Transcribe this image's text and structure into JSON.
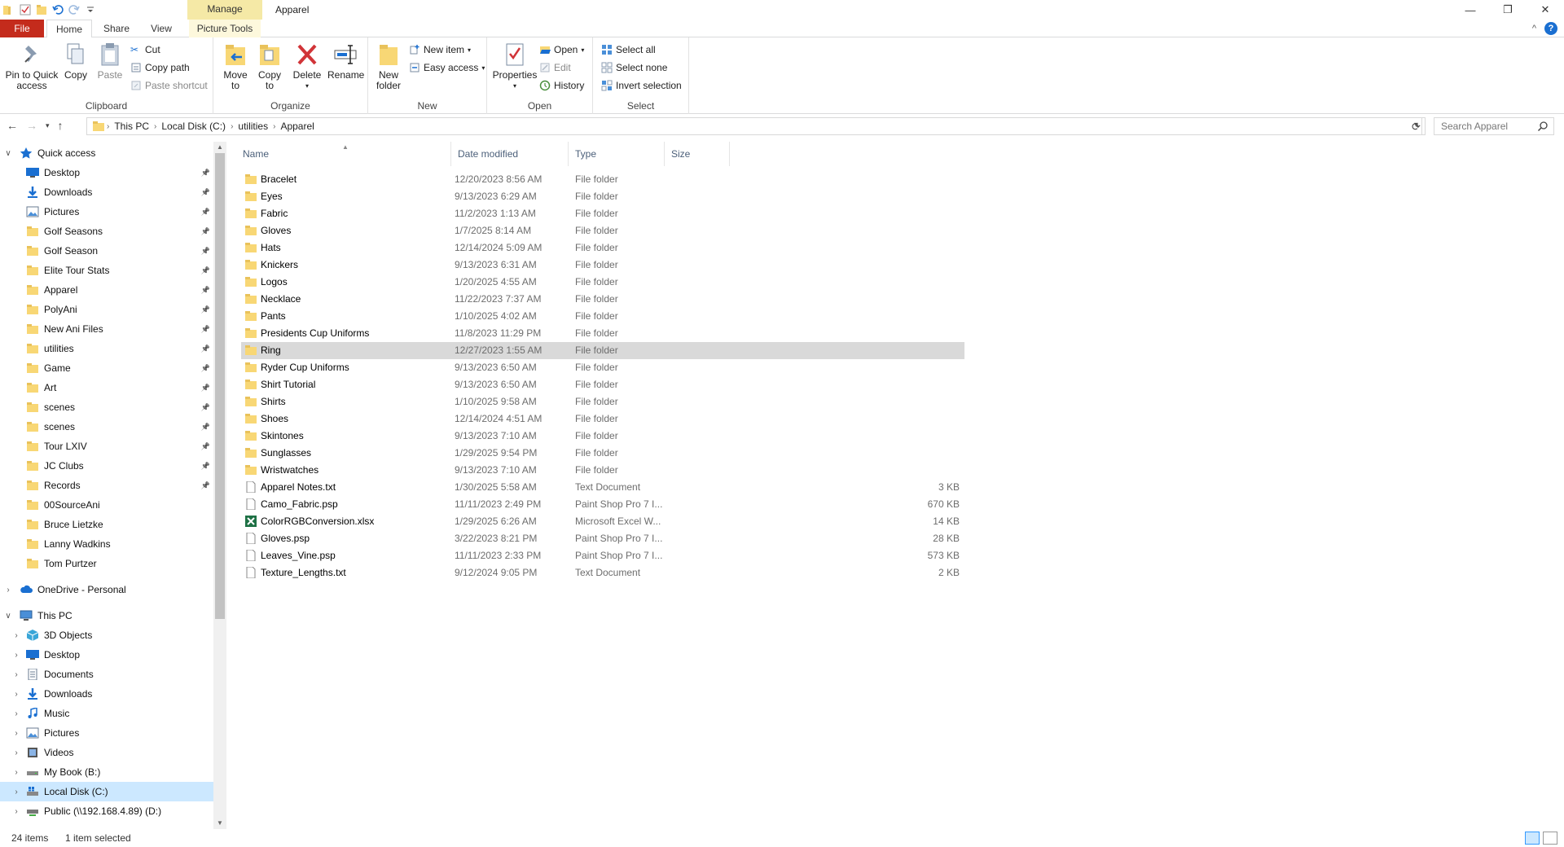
{
  "window": {
    "title": "Apparel",
    "manage_tab": "Manage",
    "controls": {
      "minimize": "—",
      "maximize": "❐",
      "close": "✕"
    }
  },
  "tabs": {
    "file": "File",
    "home": "Home",
    "share": "Share",
    "view": "View",
    "picture_tools": "Picture Tools",
    "help": "?",
    "collapse": "^"
  },
  "ribbon": {
    "clipboard": {
      "label": "Clipboard",
      "pin": "Pin to Quick access",
      "pin_l1": "Pin to Quick",
      "pin_l2": "access",
      "copy": "Copy",
      "paste": "Paste",
      "cut": "Cut",
      "copy_path": "Copy path",
      "paste_shortcut": "Paste shortcut"
    },
    "organize": {
      "label": "Organize",
      "move_l1": "Move",
      "move_l2": "to",
      "copy_l1": "Copy",
      "copy_l2": "to",
      "delete": "Delete",
      "rename": "Rename"
    },
    "new": {
      "label": "New",
      "folder_l1": "New",
      "folder_l2": "folder",
      "new_item": "New item",
      "easy_access": "Easy access"
    },
    "open": {
      "label": "Open",
      "properties": "Properties",
      "open": "Open",
      "edit": "Edit",
      "history": "History"
    },
    "select": {
      "label": "Select",
      "select_all": "Select all",
      "select_none": "Select none",
      "invert": "Invert selection"
    }
  },
  "address": {
    "crumbs": [
      "This PC",
      "Local Disk (C:)",
      "utilities",
      "Apparel"
    ],
    "search_placeholder": "Search Apparel"
  },
  "nav": {
    "quick_access": "Quick access",
    "quick_items": [
      "Desktop",
      "Downloads",
      "Pictures",
      "Golf Seasons",
      "Golf Season",
      "Elite Tour Stats",
      "Apparel",
      "PolyAni",
      "New Ani Files",
      "utilities",
      "Game",
      "Art",
      "scenes",
      "scenes",
      "Tour LXIV",
      "JC Clubs",
      "Records",
      "00SourceAni",
      "Bruce Lietzke",
      "Lanny Wadkins",
      "Tom Purtzer"
    ],
    "onedrive": "OneDrive - Personal",
    "this_pc": "This PC",
    "pc_items": [
      "3D Objects",
      "Desktop",
      "Documents",
      "Downloads",
      "Music",
      "Pictures",
      "Videos",
      "My Book (B:)",
      "Local Disk (C:)",
      "Public (\\\\192.168.4.89) (D:)"
    ]
  },
  "columns": {
    "name": "Name",
    "date": "Date modified",
    "type": "Type",
    "size": "Size"
  },
  "files": [
    {
      "name": "Bracelet",
      "date": "12/20/2023 8:56 AM",
      "type": "File folder",
      "size": "",
      "kind": "folder"
    },
    {
      "name": "Eyes",
      "date": "9/13/2023 6:29 AM",
      "type": "File folder",
      "size": "",
      "kind": "folder"
    },
    {
      "name": "Fabric",
      "date": "11/2/2023 1:13 AM",
      "type": "File folder",
      "size": "",
      "kind": "folder"
    },
    {
      "name": "Gloves",
      "date": "1/7/2025 8:14 AM",
      "type": "File folder",
      "size": "",
      "kind": "folder"
    },
    {
      "name": "Hats",
      "date": "12/14/2024 5:09 AM",
      "type": "File folder",
      "size": "",
      "kind": "folder"
    },
    {
      "name": "Knickers",
      "date": "9/13/2023 6:31 AM",
      "type": "File folder",
      "size": "",
      "kind": "folder"
    },
    {
      "name": "Logos",
      "date": "1/20/2025 4:55 AM",
      "type": "File folder",
      "size": "",
      "kind": "folder"
    },
    {
      "name": "Necklace",
      "date": "11/22/2023 7:37 AM",
      "type": "File folder",
      "size": "",
      "kind": "folder"
    },
    {
      "name": "Pants",
      "date": "1/10/2025 4:02 AM",
      "type": "File folder",
      "size": "",
      "kind": "folder"
    },
    {
      "name": "Presidents Cup Uniforms",
      "date": "11/8/2023 11:29 PM",
      "type": "File folder",
      "size": "",
      "kind": "folder"
    },
    {
      "name": "Ring",
      "date": "12/27/2023 1:55 AM",
      "type": "File folder",
      "size": "",
      "kind": "folder",
      "selected": true
    },
    {
      "name": "Ryder Cup Uniforms",
      "date": "9/13/2023 6:50 AM",
      "type": "File folder",
      "size": "",
      "kind": "folder"
    },
    {
      "name": "Shirt Tutorial",
      "date": "9/13/2023 6:50 AM",
      "type": "File folder",
      "size": "",
      "kind": "folder"
    },
    {
      "name": "Shirts",
      "date": "1/10/2025 9:58 AM",
      "type": "File folder",
      "size": "",
      "kind": "folder"
    },
    {
      "name": "Shoes",
      "date": "12/14/2024 4:51 AM",
      "type": "File folder",
      "size": "",
      "kind": "folder"
    },
    {
      "name": "Skintones",
      "date": "9/13/2023 7:10 AM",
      "type": "File folder",
      "size": "",
      "kind": "folder"
    },
    {
      "name": "Sunglasses",
      "date": "1/29/2025 9:54 PM",
      "type": "File folder",
      "size": "",
      "kind": "folder"
    },
    {
      "name": "Wristwatches",
      "date": "9/13/2023 7:10 AM",
      "type": "File folder",
      "size": "",
      "kind": "folder"
    },
    {
      "name": "Apparel Notes.txt",
      "date": "1/30/2025 5:58 AM",
      "type": "Text Document",
      "size": "3 KB",
      "kind": "doc"
    },
    {
      "name": "Camo_Fabric.psp",
      "date": "11/11/2023 2:49 PM",
      "type": "Paint Shop Pro 7 I...",
      "size": "670 KB",
      "kind": "doc"
    },
    {
      "name": "ColorRGBConversion.xlsx",
      "date": "1/29/2025 6:26 AM",
      "type": "Microsoft Excel W...",
      "size": "14 KB",
      "kind": "excel"
    },
    {
      "name": "Gloves.psp",
      "date": "3/22/2023 8:21 PM",
      "type": "Paint Shop Pro 7 I...",
      "size": "28 KB",
      "kind": "doc"
    },
    {
      "name": "Leaves_Vine.psp",
      "date": "11/11/2023 2:33 PM",
      "type": "Paint Shop Pro 7 I...",
      "size": "573 KB",
      "kind": "doc"
    },
    {
      "name": "Texture_Lengths.txt",
      "date": "9/12/2024 9:05 PM",
      "type": "Text Document",
      "size": "2 KB",
      "kind": "doc"
    }
  ],
  "status": {
    "count": "24 items",
    "selection": "1 item selected"
  },
  "colors": {
    "folder": "#f8d775",
    "accent": "#1a6fd1",
    "file_tab": "#c42b1c",
    "selected_nav": "#cce8ff"
  }
}
